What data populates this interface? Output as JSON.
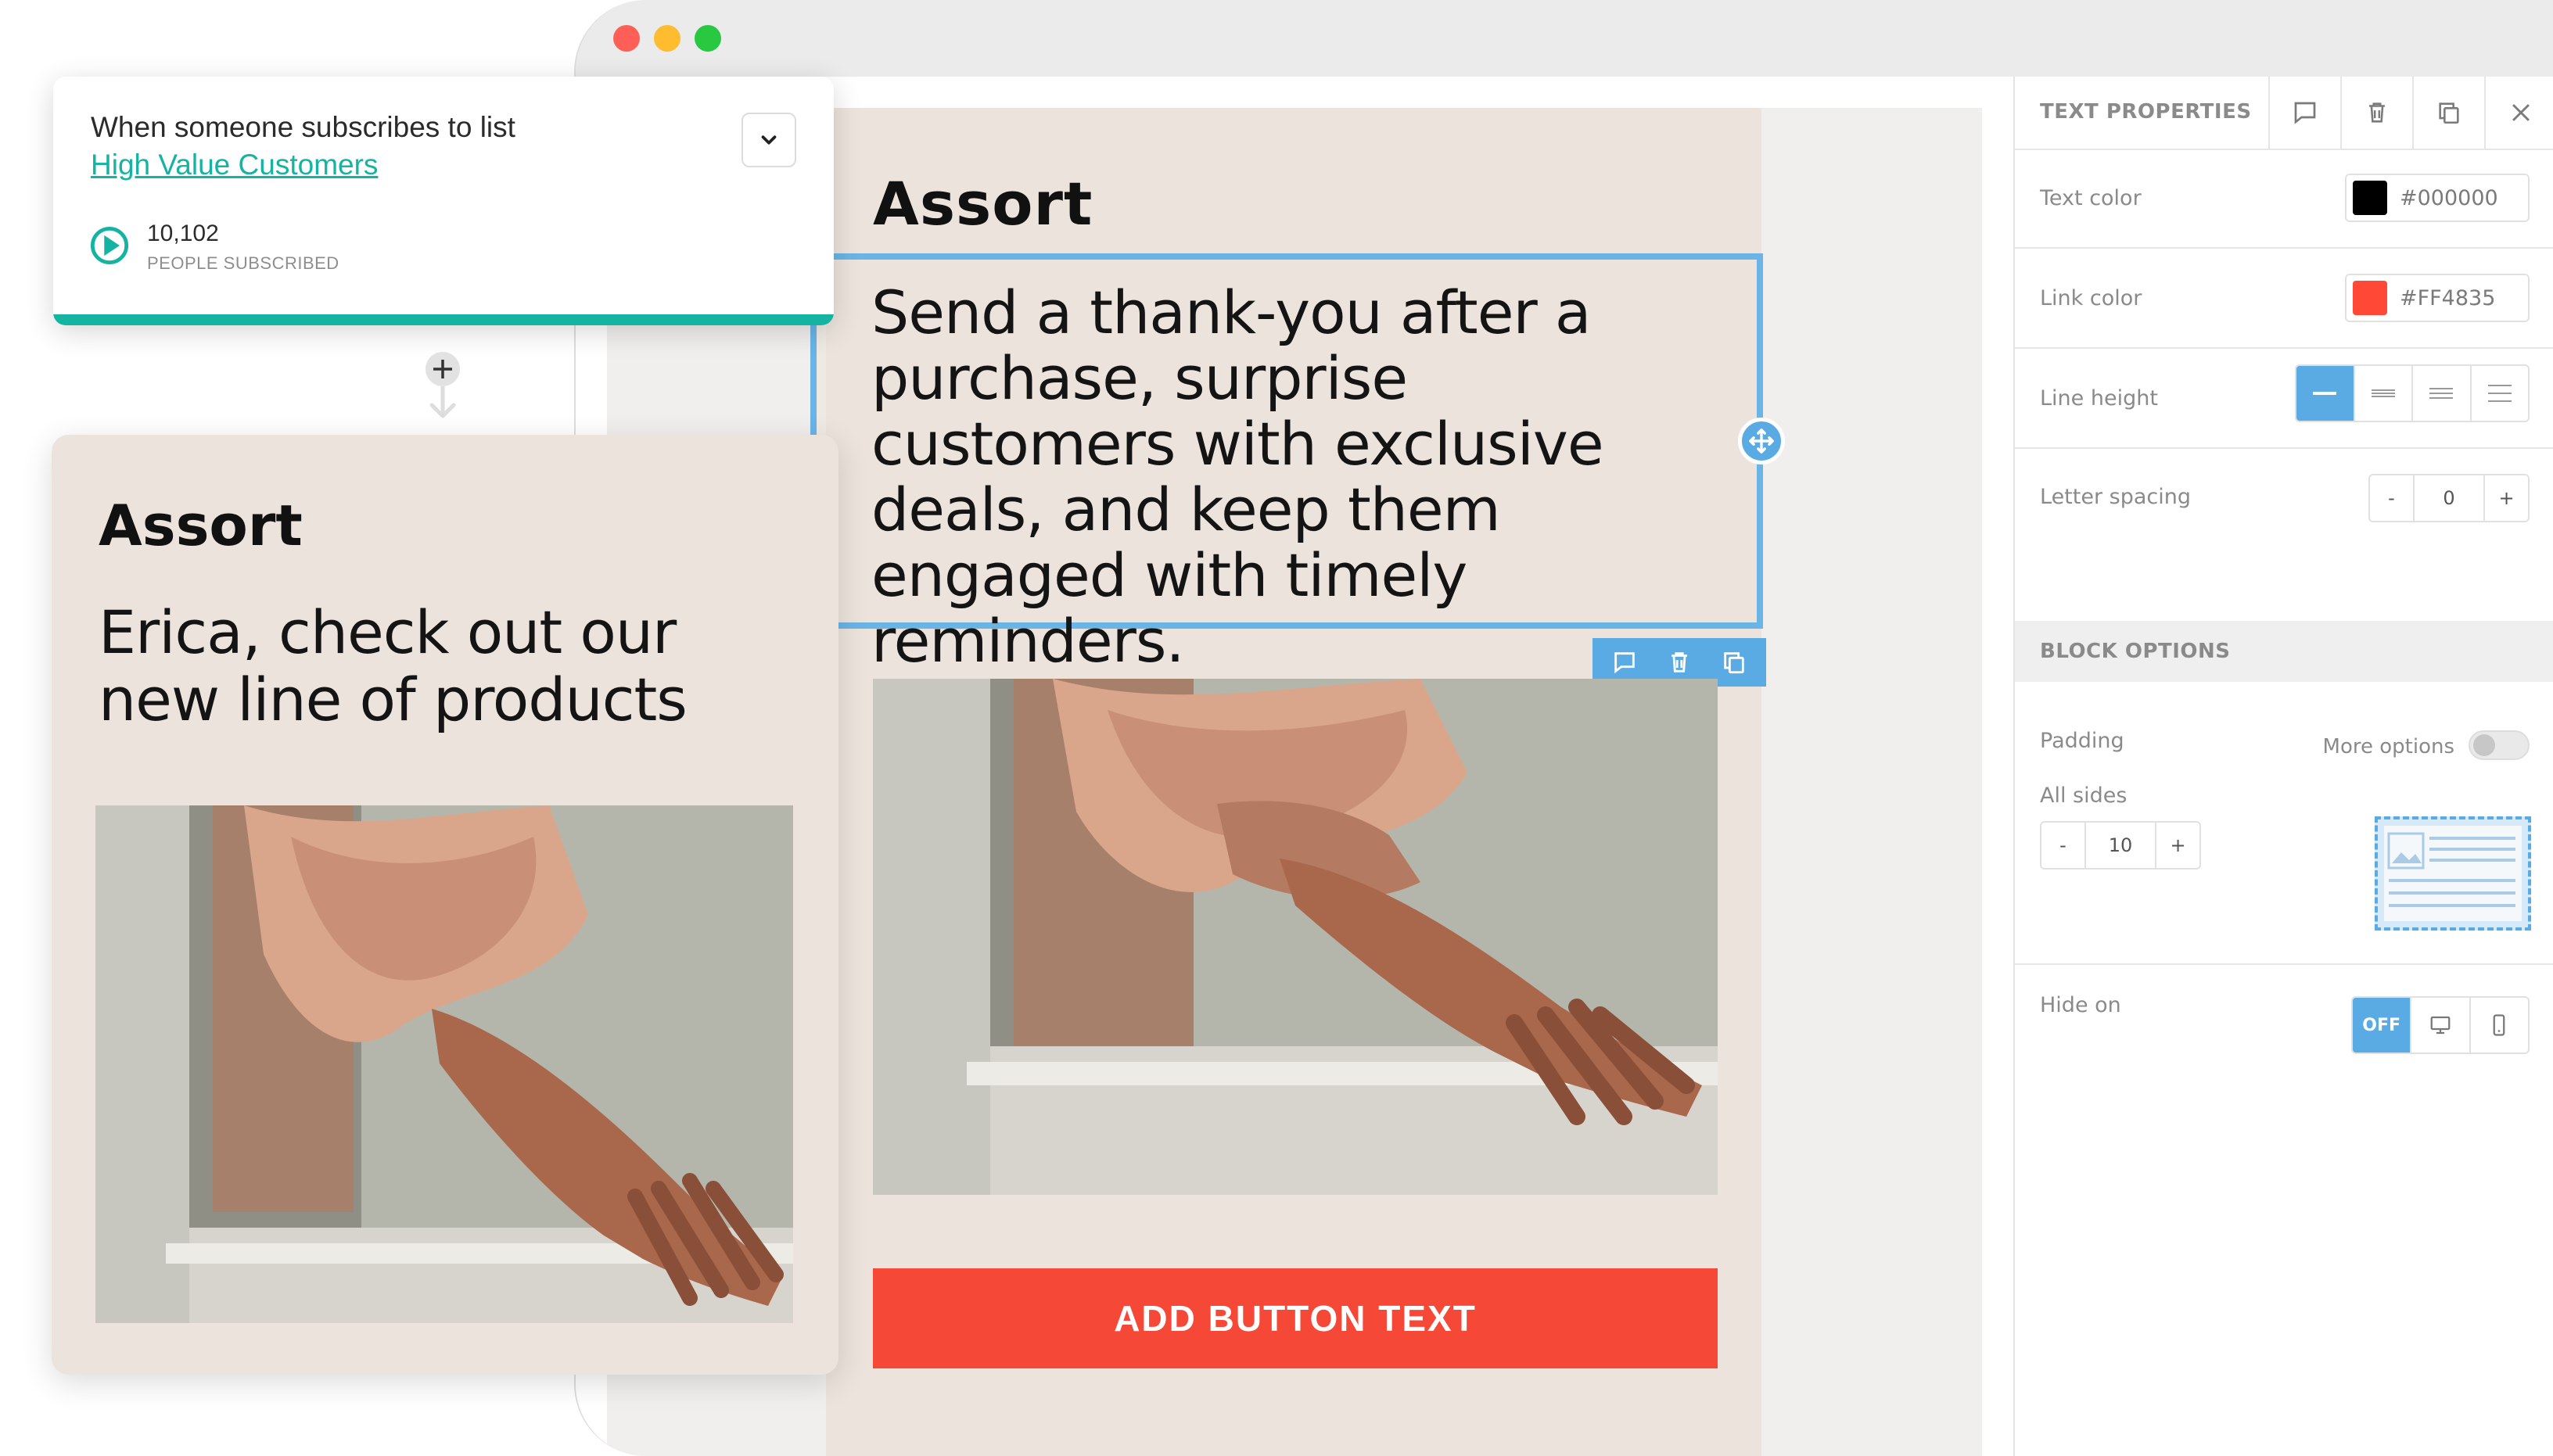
{
  "trigger_card": {
    "line1": "When someone subscribes to list",
    "list_name": "High Value Customers",
    "count": "10,102",
    "count_label": "PEOPLE SUBSCRIBED"
  },
  "preview_card": {
    "brand": "Assort",
    "message": "Erica, check out our new line of products"
  },
  "email": {
    "brand": "Assort",
    "body_text": "Send a thank-you after a purchase, surprise customers with exclusive deals, and keep them engaged with timely reminders.",
    "button_label": "ADD BUTTON TEXT"
  },
  "panel": {
    "title": "TEXT PROPERTIES",
    "text_color_label": "Text color",
    "text_color_value": "#000000",
    "link_color_label": "Link color",
    "link_color_value": "#FF4835",
    "line_height_label": "Line height",
    "letter_spacing_label": "Letter spacing",
    "letter_spacing_value": "0",
    "block_options_title": "BLOCK OPTIONS",
    "padding_label": "Padding",
    "more_options_label": "More options",
    "all_sides_label": "All sides",
    "padding_value": "10",
    "hide_on_label": "Hide on",
    "hide_off_label": "OFF",
    "minus": "-",
    "plus": "+"
  },
  "colors": {
    "accent_teal": "#15b3a1",
    "selection_blue": "#5aabe4",
    "button_red": "#f64837",
    "email_bg": "#ece4dc"
  },
  "icons": [
    "chevron-down-icon",
    "play-circle-icon",
    "plus-circle-icon",
    "move-icon",
    "comment-icon",
    "trash-icon",
    "copy-icon",
    "close-icon",
    "desktop-icon",
    "mobile-icon",
    "image-placeholder-icon"
  ]
}
